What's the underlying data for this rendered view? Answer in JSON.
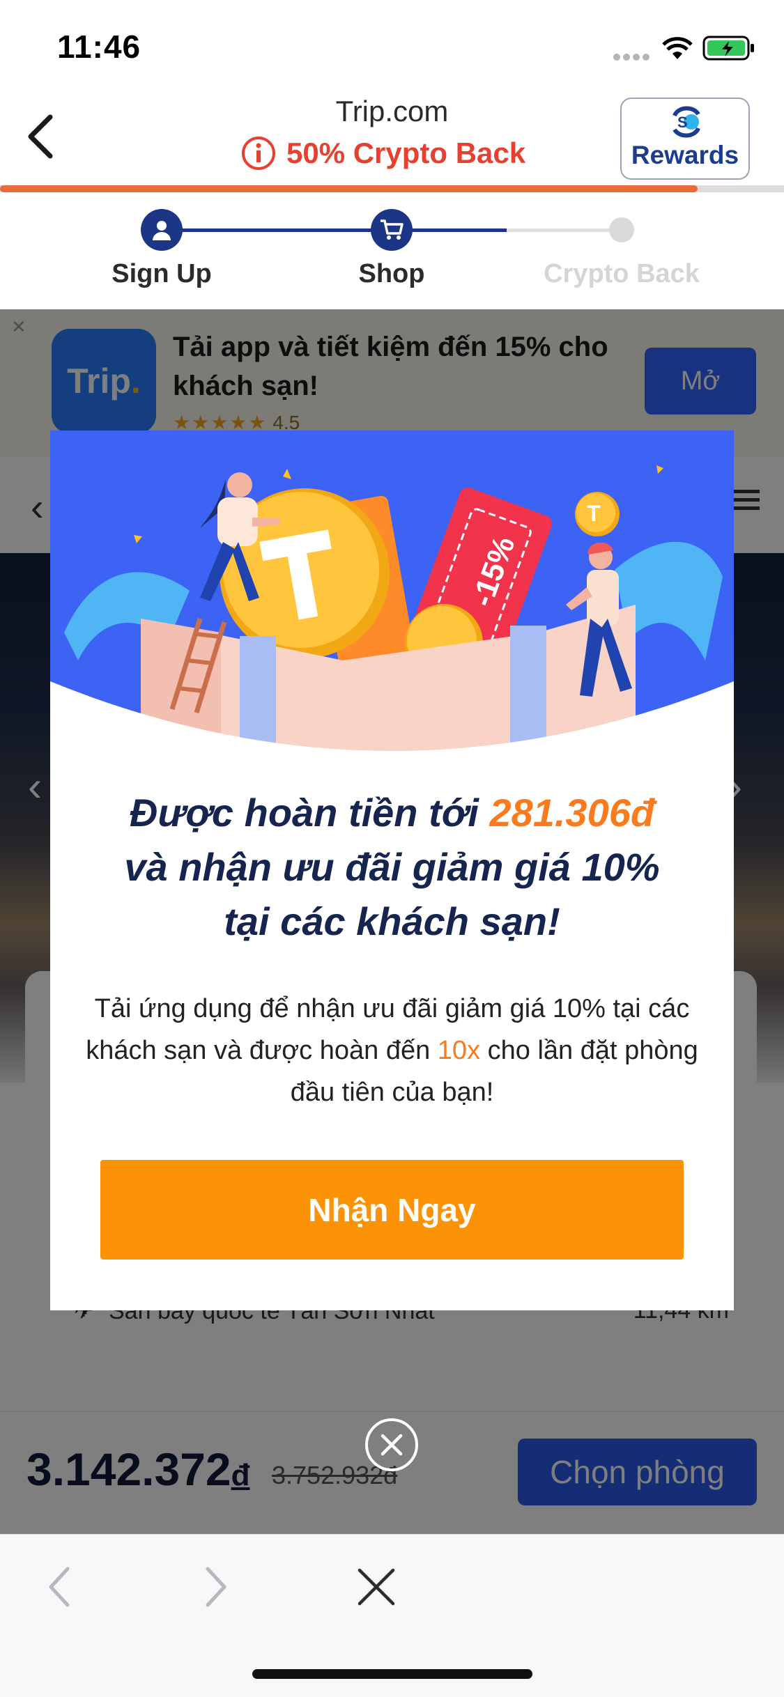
{
  "status_bar": {
    "time": "11:46"
  },
  "header": {
    "title": "Trip.com",
    "subtitle": "50% Crypto Back",
    "rewards_label": "Rewards",
    "progress_percent": 89
  },
  "steps": [
    {
      "label": "Sign Up",
      "state": "done",
      "icon": "user-icon"
    },
    {
      "label": "Shop",
      "state": "current",
      "icon": "cart-icon"
    },
    {
      "label": "Crypto Back",
      "state": "pending"
    }
  ],
  "background_page": {
    "app_banner": {
      "app_icon_text": "Trip",
      "text": "Tải app và tiết kiệm đến 15% cho khách sạn!",
      "rating": "4.5",
      "open_button": "Mở"
    },
    "poi": [
      {
        "name": "Sân bay quốc tế Tân Sơn Nhất",
        "distance": "11,44 km",
        "icon": "plane-icon"
      }
    ],
    "price": "3.142.372",
    "currency": "đ",
    "old_price": "3.752.932đ",
    "choose_room_button": "Chọn phòng"
  },
  "modal": {
    "title_pre": "Được hoàn tiền tới ",
    "title_amount": "281.306đ",
    "title_post": "và nhận ưu đãi giảm giá 10% tại các khách sạn!",
    "desc_pre": "Tải ứng dụng để nhận ưu đãi giảm giá 10% tại các khách sạn và được hoàn đến ",
    "desc_highlight": "10x",
    "desc_post": " cho lần đặt phòng đầu tiên của bạn!",
    "cta_label": "Nhận Ngay",
    "ticket_label": "-15%"
  },
  "colors": {
    "accent_orange": "#fc9307",
    "highlight_orange": "#fa7a1e",
    "navy": "#1c3685",
    "crypto_red": "#e8402e",
    "modal_blue": "#3d63f5"
  }
}
